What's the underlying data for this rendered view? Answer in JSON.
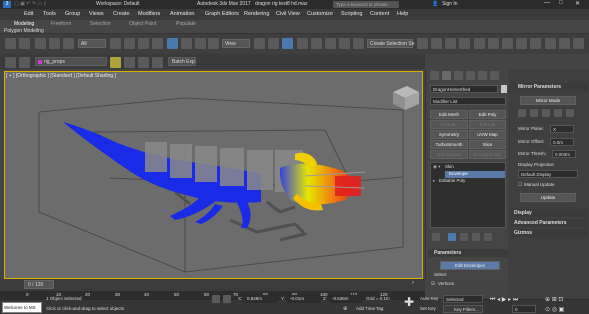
{
  "titlebar": {
    "workspace_label": "Workspace: Default",
    "app_title": "Autodesk 3ds Max 2017",
    "file_title": "dragon rig test8 hd.max",
    "search_placeholder": "Type a keyword or phrase",
    "sign_in": "Sign In",
    "help": "?"
  },
  "menus": [
    "Edit",
    "Tools",
    "Group",
    "Views",
    "Create",
    "Modifiers",
    "Animation",
    "Graph Editors",
    "Rendering",
    "Civil View",
    "Customize",
    "Scripting",
    "Content",
    "Help"
  ],
  "ribbon": {
    "tabs": [
      "Modeling",
      "Freeform",
      "Selection",
      "Object Paint",
      "Populate"
    ],
    "sub_label": "Polygon Modeling"
  },
  "toolbar": {
    "filter": "All",
    "view": "View",
    "selection_set": "Create Selection Se"
  },
  "toolbar2": {
    "layer": "rig_props",
    "batch": "Batch Exp"
  },
  "viewport": {
    "label": "[ + ] [Orthographic ] [Standard ] [Default Shading ]"
  },
  "cmd": {
    "object_name": "DragonHomeShed",
    "modifier_list": "Modifier List",
    "buttons": [
      "Edit Mesh",
      "Edit Poly",
      "Extrude",
      "Extrude",
      "Symmetry",
      "UVW Map",
      "TurboSmooth",
      "Slice",
      "Edit Splinex",
      "Normalize Spl."
    ],
    "stack": [
      "Skin",
      "Envelope",
      "Editable Poly"
    ],
    "parameters_title": "Parameters",
    "edit_envelopes": "Edit Envelopes",
    "select_label": "Select",
    "vertices_label": "Vertices"
  },
  "mirror": {
    "title": "Mirror Parameters",
    "mode": "Mirror Mode",
    "plane_label": "Mirror Plane:",
    "plane_value": "X",
    "offset_label": "Mirror Offset:",
    "offset_value": "0.0m",
    "thresh_label": "Mirror Thresh.:",
    "thresh_value": "0.003m",
    "projection_label": "Display Projection",
    "projection_value": "Default Display",
    "manual_update": "Manual Update",
    "update": "Update",
    "display": "Display",
    "advanced": "Advanced Parameters",
    "gizmos": "Gizmos"
  },
  "timeline": {
    "frame_range": "0 / 120",
    "ticks": [
      "0",
      "10",
      "20",
      "30",
      "40",
      "50",
      "60",
      "70",
      "80",
      "90",
      "100",
      "110",
      "120"
    ]
  },
  "status": {
    "welcome": "Welcome to MS",
    "selected": "1 Object Selected",
    "hint": "Click or click-and-drag to select objects",
    "x_label": "X:",
    "x_value": "0.848m",
    "y_label": "Y:",
    "y_value": "-0.01m",
    "z_label": "Z:",
    "z_value": "-0.636m",
    "grid": "Grid = 0.1m",
    "add_time_tag": "Add Time Tag",
    "auto_key": "Auto Key",
    "set_key": "Set Key",
    "key_mode": "Selected",
    "key_filters": "Key Filters...",
    "frame": "0"
  }
}
